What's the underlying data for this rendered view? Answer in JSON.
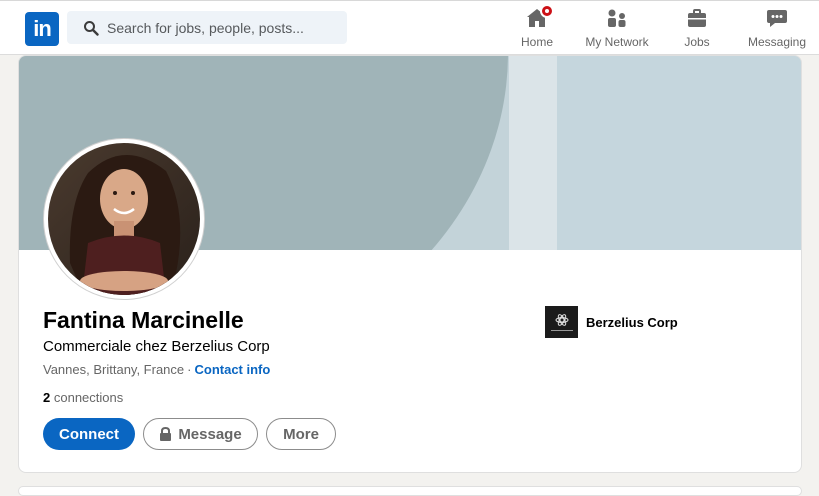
{
  "nav": {
    "logo_text": "in",
    "search_placeholder": "Search for jobs, people, posts...",
    "items": [
      {
        "label": "Home",
        "icon": "home-icon",
        "badge": true
      },
      {
        "label": "My Network",
        "icon": "people-icon",
        "badge": false
      },
      {
        "label": "Jobs",
        "icon": "briefcase-icon",
        "badge": false
      },
      {
        "label": "Messaging",
        "icon": "chat-icon",
        "badge": false
      }
    ],
    "badge_color": "#cc1016"
  },
  "profile": {
    "name": "Fantina Marcinelle",
    "headline": "Commerciale chez Berzelius Corp",
    "location": "Vannes, Brittany, France",
    "separator": "·",
    "contact_info": "Contact info",
    "connections_count": "2",
    "connections_label": "connections",
    "company": "Berzelius Corp"
  },
  "actions": {
    "connect": "Connect",
    "message": "Message",
    "more": "More"
  },
  "colors": {
    "brand": "#0a66c2",
    "banner_bg": "#c3d3d9",
    "banner_arc": "#a0b4b8"
  }
}
